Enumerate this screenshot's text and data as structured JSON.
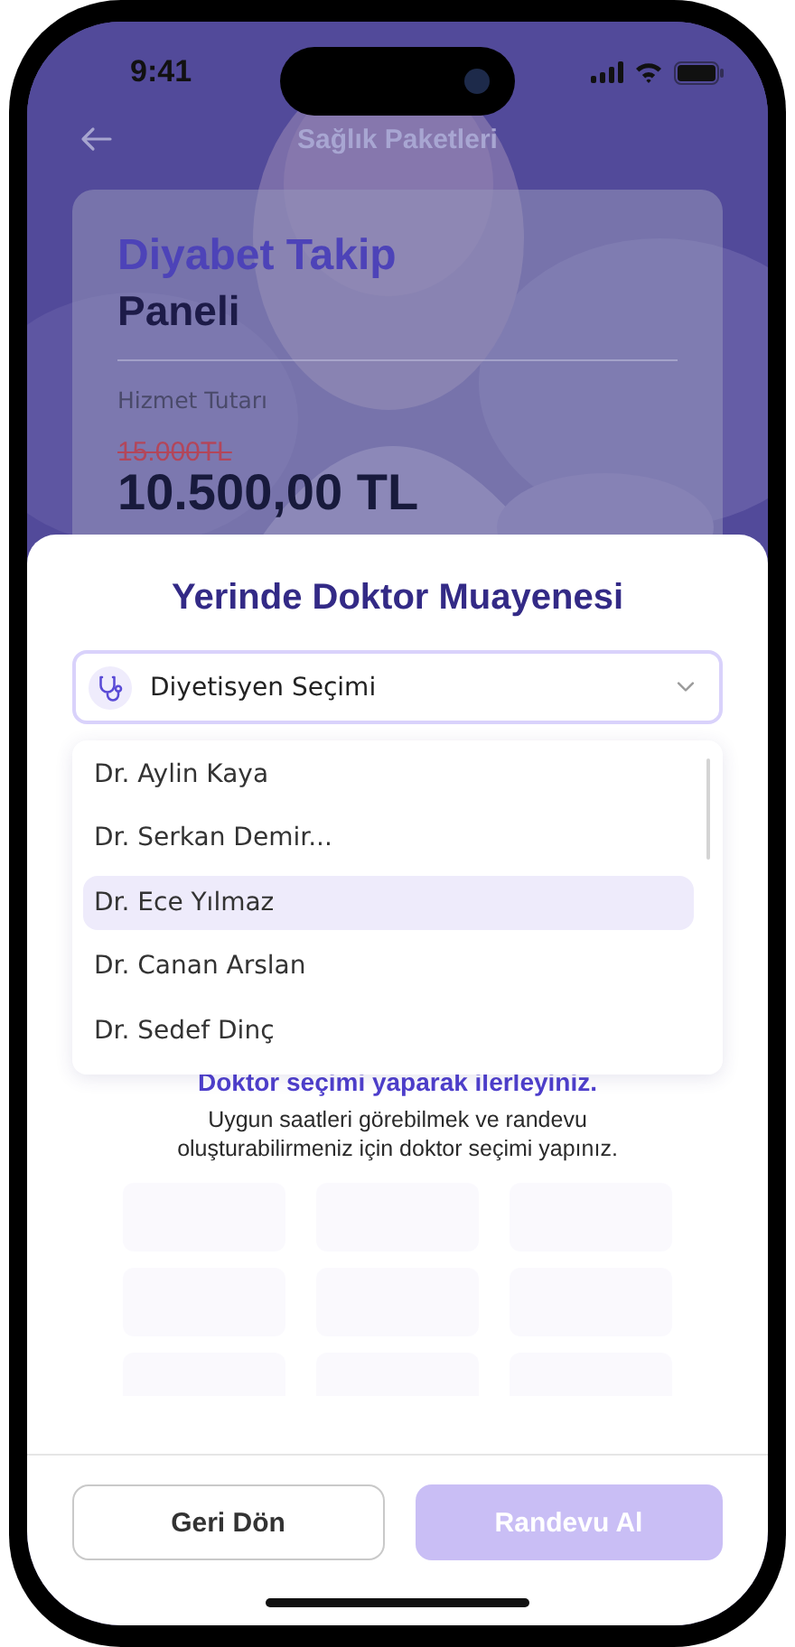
{
  "status_bar": {
    "time": "9:41"
  },
  "header": {
    "title": "Sağlık Paketleri"
  },
  "package_card": {
    "title": "Diyabet Takip",
    "subtitle": "Paneli",
    "price_label": "Hizmet Tutarı",
    "old_price": "15.000TL",
    "price": "10.500,00 TL"
  },
  "sheet": {
    "title": "Yerinde Doktor Muayenesi",
    "dropdown": {
      "value": "Diyetisyen Seçimi",
      "expanded": true,
      "options": [
        {
          "label": "Dr. Aylin Kaya",
          "selected": false
        },
        {
          "label": "Dr. Serkan Demir...",
          "selected": false
        },
        {
          "label": "Dr. Ece Yılmaz",
          "selected": true
        },
        {
          "label": "Dr. Canan Arslan",
          "selected": false
        },
        {
          "label": "Dr. Sedef Dinç",
          "selected": false
        }
      ]
    },
    "notice": {
      "title": "Doktor seçimi yaparak ilerleyiniz.",
      "text": "Uygun saatleri görebilmek ve randevu oluşturabilirmeniz için doktor seçimi yapınız."
    },
    "buttons": [
      {
        "label": "Geri Dön",
        "kind": "secondary",
        "disabled": false
      },
      {
        "label": "Randevu Al",
        "kind": "primary",
        "disabled": true
      }
    ]
  }
}
